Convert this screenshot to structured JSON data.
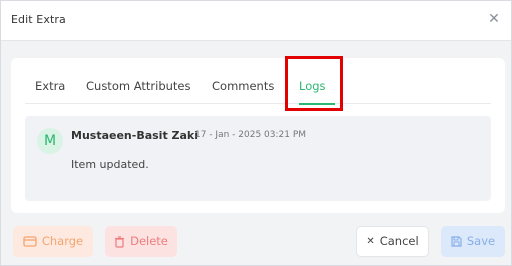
{
  "dialog": {
    "title": "Edit Extra",
    "close_glyph": "✕"
  },
  "tabs": [
    {
      "label": "Extra",
      "active": false
    },
    {
      "label": "Custom Attributes",
      "active": false
    },
    {
      "label": "Comments",
      "active": false
    },
    {
      "label": "Logs",
      "active": true
    }
  ],
  "logs": [
    {
      "avatar_initial": "M",
      "author": "Mustaeen-Basit Zaki",
      "timestamp": "17 - Jan - 2025 03:21 PM",
      "message": "Item updated."
    }
  ],
  "footer": {
    "charge_label": "Charge",
    "delete_label": "Delete",
    "cancel_label": "Cancel",
    "save_label": "Save",
    "cancel_glyph": "✕"
  },
  "colors": {
    "accent": "#2bb673",
    "highlight": "#e30000",
    "charge": "#f6a46e",
    "delete": "#ee7b7b",
    "save": "#86aee8"
  },
  "icons": {
    "close": "close-icon",
    "charge": "credit-card-icon",
    "delete": "trash-icon",
    "cancel": "close-icon",
    "save": "floppy-disk-icon"
  }
}
